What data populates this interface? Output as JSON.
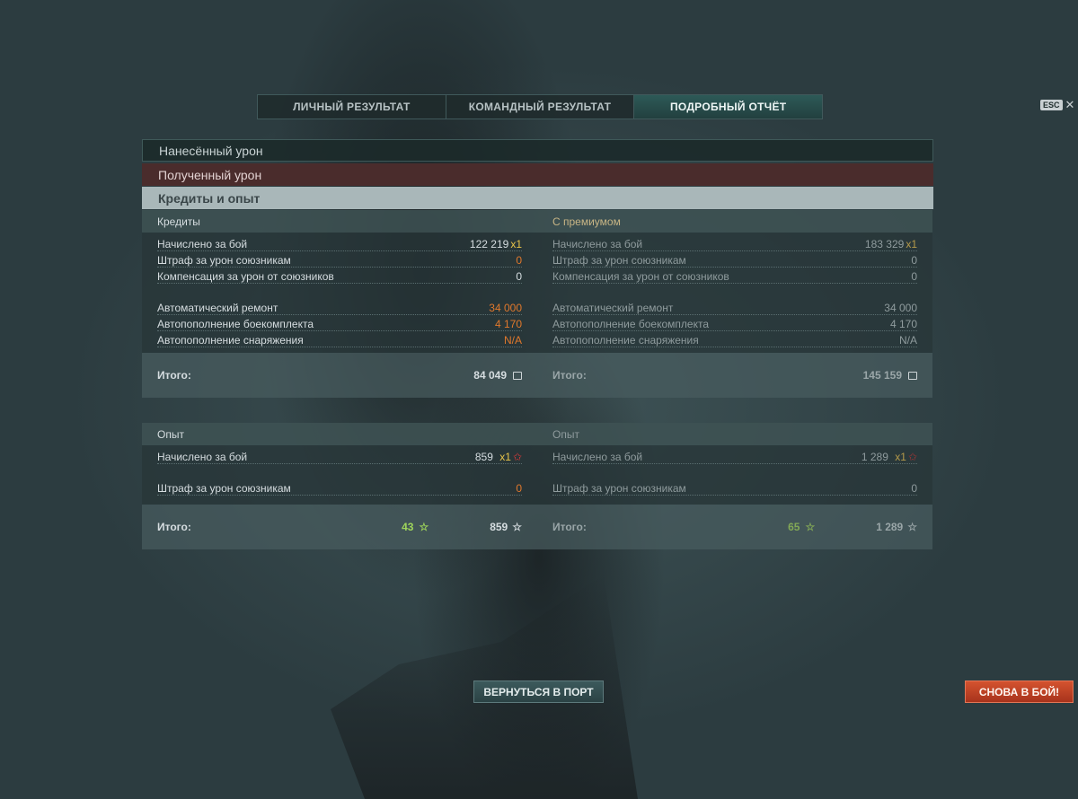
{
  "tabs": [
    {
      "label": "ЛИЧНЫЙ РЕЗУЛЬТАТ"
    },
    {
      "label": "КОМАНДНЫЙ РЕЗУЛЬТАТ"
    },
    {
      "label": "ПОДРОБНЫЙ ОТЧЁТ",
      "active": true
    }
  ],
  "esc": {
    "badge": "ESC",
    "close": "✕"
  },
  "sections": {
    "damage_dealt": "Нанесённый урон",
    "damage_received": "Полученный урон",
    "credits_xp": "Кредиты и опыт"
  },
  "credits": {
    "left": {
      "header": "Кредиты",
      "earned_label": "Начислено за бой",
      "earned_value": "122 219",
      "earned_mult": "x1",
      "penalty_label": "Штраф за урон союзникам",
      "penalty_value": "0",
      "comp_label": "Компенсация за урон от союзников",
      "comp_value": "0",
      "repair_label": "Автоматический ремонт",
      "repair_value": "34 000",
      "ammo_label": "Автопополнение боекомплекта",
      "ammo_value": "4 170",
      "equip_label": "Автопополнение снаряжения",
      "equip_value": "N/A",
      "total_label": "Итого:",
      "total_value": "84 049"
    },
    "right": {
      "header": "С премиумом",
      "earned_label": "Начислено за бой",
      "earned_value": "183 329",
      "earned_mult": "x1",
      "penalty_label": "Штраф за урон союзникам",
      "penalty_value": "0",
      "comp_label": "Компенсация за урон от союзников",
      "comp_value": "0",
      "repair_label": "Автоматический ремонт",
      "repair_value": "34 000",
      "ammo_label": "Автопополнение боекомплекта",
      "ammo_value": "4 170",
      "equip_label": "Автопополнение снаряжения",
      "equip_value": "N/A",
      "total_label": "Итого:",
      "total_value": "145 159"
    }
  },
  "experience": {
    "left": {
      "header": "Опыт",
      "earned_label": "Начислено за бой",
      "earned_value": "859",
      "earned_mult": "x1",
      "penalty_label": "Штраф за урон союзникам",
      "penalty_value": "0",
      "total_label": "Итого:",
      "total_free_xp": "43",
      "total_value": "859"
    },
    "right": {
      "header": "Опыт",
      "earned_label": "Начислено за бой",
      "earned_value": "1 289",
      "earned_mult": "x1",
      "penalty_label": "Штраф за урон союзникам",
      "penalty_value": "0",
      "total_label": "Итого:",
      "total_free_xp": "65",
      "total_value": "1 289"
    }
  },
  "buttons": {
    "return_port": "ВЕРНУТЬСЯ В ПОРТ",
    "battle_again": "СНОВА В БОЙ!"
  },
  "icons": {
    "star": "☆",
    "xp": "✩",
    "coin": "credits-icon"
  },
  "colors": {
    "accent_tab": "#2d5a57",
    "battle_button": "#c2442a",
    "negative": "#e0782c",
    "multiplier": "#e8c449",
    "free_xp": "#9fd65a"
  }
}
